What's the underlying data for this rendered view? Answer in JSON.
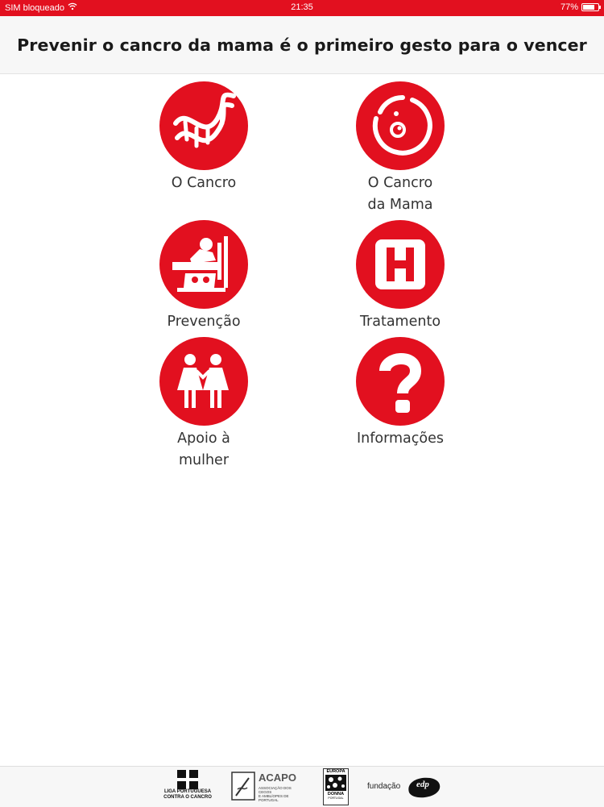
{
  "status_bar": {
    "carrier": "SIM bloqueado",
    "time": "21:35",
    "battery": "77%",
    "battery_level": 0.77
  },
  "header": {
    "title": "Prevenir o cancro da mama é o primeiro gesto para o vencer"
  },
  "menu": [
    {
      "label_lines": [
        "O Cancro"
      ],
      "icon": "dna-icon"
    },
    {
      "label_lines": [
        "O Cancro",
        "da Mama"
      ],
      "icon": "breast-icon"
    },
    {
      "label_lines": [
        "Prevenção"
      ],
      "icon": "mammography-icon"
    },
    {
      "label_lines": [
        "Tratamento"
      ],
      "icon": "hospital-icon"
    },
    {
      "label_lines": [
        "Apoio à",
        "mulher"
      ],
      "icon": "women-icon"
    },
    {
      "label_lines": [
        "Informações"
      ],
      "icon": "question-icon"
    }
  ],
  "footer": {
    "logos": [
      {
        "name": "liga-portuguesa-logo",
        "text_lines": [
          "LIGA PORTUGUESA",
          "CONTRA O CANCRO"
        ]
      },
      {
        "name": "acapo-logo",
        "text_lines": [
          "ACAPO",
          "ASSOCIAÇÃO DOS CEGOS",
          "E AMBLÍOPES DE PORTUGAL"
        ]
      },
      {
        "name": "europa-donna-logo",
        "text_lines": [
          "EUROPA",
          "DONNA",
          "PORTUGAL"
        ]
      },
      {
        "name": "fundacao-edp-logo",
        "text_lines": [
          "fundação",
          "edp"
        ]
      }
    ]
  },
  "colors": {
    "accent": "#e2101f",
    "label_text": "#333333",
    "title_text": "#1a1a1a"
  }
}
